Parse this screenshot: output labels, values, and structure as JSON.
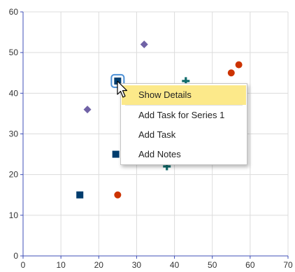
{
  "chart_data": {
    "type": "scatter",
    "title": "",
    "xlabel": "",
    "ylabel": "",
    "xlim": [
      0,
      70
    ],
    "ylim": [
      0,
      60
    ],
    "x_ticks": [
      "0",
      "10",
      "20",
      "30",
      "40",
      "50",
      "60",
      "70"
    ],
    "y_ticks": [
      "0",
      "10",
      "20",
      "30",
      "40",
      "50",
      "60"
    ],
    "grid": true,
    "series": [
      {
        "marker": "square",
        "color": "#003d6e",
        "points": [
          [
            15,
            15
          ],
          [
            24.5,
            25
          ],
          [
            25,
            43
          ]
        ]
      },
      {
        "marker": "circle",
        "color": "#cc3300",
        "points": [
          [
            25,
            15
          ],
          [
            55,
            45
          ],
          [
            57,
            47
          ]
        ]
      },
      {
        "marker": "plus",
        "color": "#0f6b6b",
        "points": [
          [
            38,
            22
          ],
          [
            43,
            43
          ]
        ]
      },
      {
        "marker": "diamond",
        "color": "#7062a6",
        "points": [
          [
            17,
            36
          ],
          [
            32,
            52
          ]
        ]
      }
    ],
    "highlighted_point": {
      "series_index": 0,
      "point_index": 2
    }
  },
  "context_menu": {
    "items": [
      "Show Details",
      "Add Task for Series 1",
      "Add Task",
      "Add Notes"
    ],
    "active_index": 0
  },
  "colors": {
    "axis": "#3f4fb7",
    "grid": "#dcdcdc",
    "menu_highlight": "#fce98a",
    "focus_ring": "#4a8fd6"
  }
}
